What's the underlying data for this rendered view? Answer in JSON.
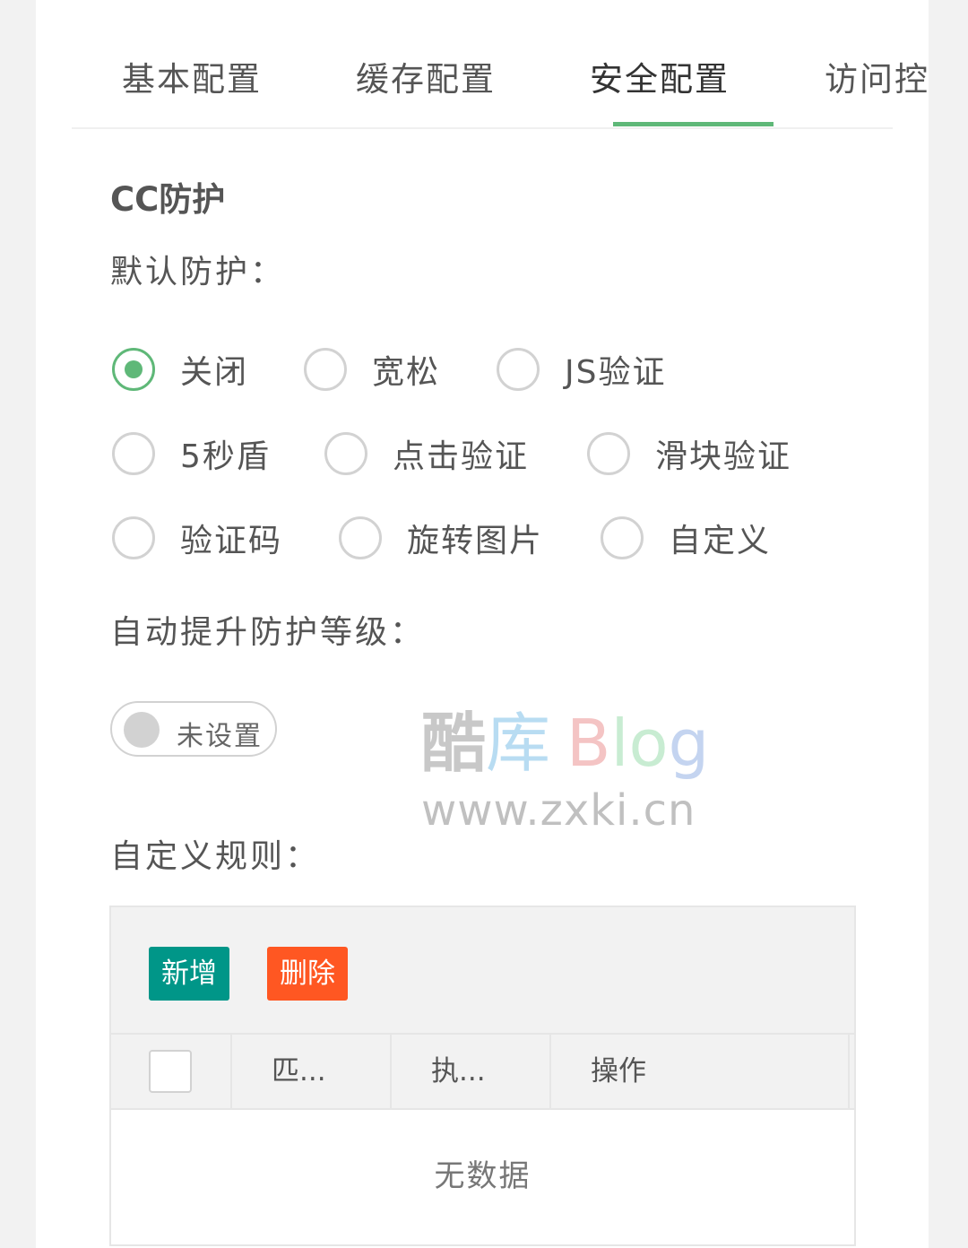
{
  "tabs": [
    "基本配置",
    "缓存配置",
    "安全配置",
    "访问控制"
  ],
  "section": {
    "title": "CC防护"
  },
  "default_protection": {
    "label": "默认防护：",
    "options": [
      "关闭",
      "宽松",
      "JS验证",
      "5秒盾",
      "点击验证",
      "滑块验证",
      "验证码",
      "旋转图片",
      "自定义"
    ],
    "selected": "关闭"
  },
  "auto_raise": {
    "label": "自动提升防护等级：",
    "switch_text": "未设置"
  },
  "watermark": {
    "name_parts": [
      "酷",
      "库",
      "B",
      "lo",
      "g"
    ],
    "url": "www.zxki.cn"
  },
  "custom_rules": {
    "label": "自定义规则：",
    "add_button": "新增",
    "delete_button": "删除",
    "columns": [
      "匹...",
      "执...",
      "操作"
    ],
    "empty_text": "无数据"
  },
  "colors": {
    "accent": "#5fb878",
    "add": "#009688",
    "delete": "#ff5722"
  }
}
